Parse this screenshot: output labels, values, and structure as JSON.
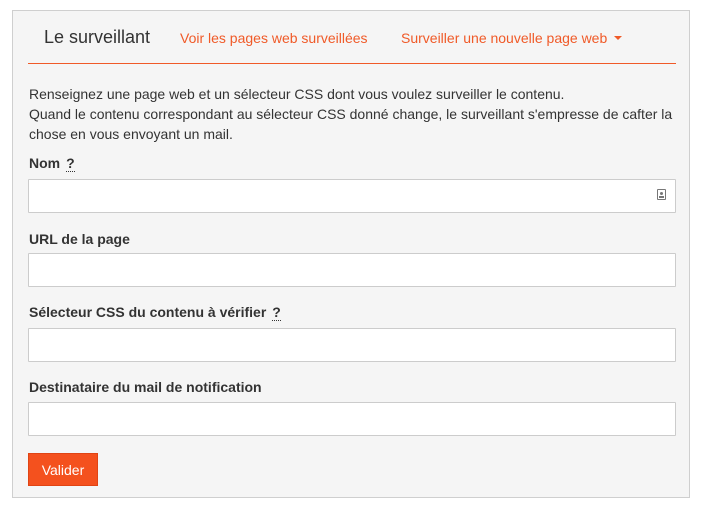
{
  "navbar": {
    "brand": "Le surveillant",
    "links": [
      {
        "label": "Voir les pages web surveillées"
      },
      {
        "label": "Surveiller une nouvelle page web",
        "has_dropdown": true
      }
    ]
  },
  "intro": {
    "line1": "Renseignez une page web et un sélecteur CSS dont vous voulez surveiller le contenu.",
    "line2": "Quand le contenu correspondant au sélecteur CSS donné change, le surveillant s'empresse de cafter la chose en vous envoyant un mail."
  },
  "form": {
    "name": {
      "label": "Nom",
      "help": "?",
      "value": "",
      "placeholder": ""
    },
    "url": {
      "label": "URL de la page",
      "value": "",
      "placeholder": ""
    },
    "selector": {
      "label": "Sélecteur CSS du contenu à vérifier",
      "help": "?",
      "value": "",
      "placeholder": ""
    },
    "recipient": {
      "label": "Destinataire du mail de notification",
      "value": "",
      "placeholder": ""
    },
    "submit_label": "Valider"
  },
  "colors": {
    "accent": "#f05a28",
    "button": "#f4511e",
    "panel_bg": "#f5f5f5",
    "text": "#333333"
  },
  "icons": {
    "name_field_icon": "contact-card-icon",
    "dropdown_icon": "caret-down-icon"
  }
}
